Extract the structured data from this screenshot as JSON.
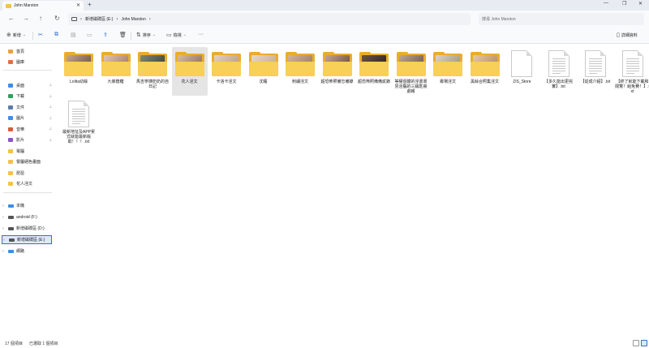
{
  "window": {
    "tab_title": "John Marston",
    "tab_close": "✕",
    "new_tab": "+",
    "minimize": "—",
    "maximize": "❐",
    "close": "✕"
  },
  "nav_buttons": {
    "back": "←",
    "forward": "→",
    "up": "↑",
    "refresh": "↻"
  },
  "breadcrumb": [
    "新增磁碟區 (E:)",
    "John Marston"
  ],
  "breadcrumb_separator": "›",
  "search": {
    "placeholder": "搜尋 John Marston"
  },
  "command_bar": {
    "new_label": "新增",
    "sort_label": "排序",
    "view_label": "檢視",
    "more_label": "···",
    "details_label": "詳細資料"
  },
  "navigation_pane": {
    "quick_items": [
      {
        "label": "首頁",
        "icon": "home-icon",
        "color": "#e9a23b",
        "pinned": false
      },
      {
        "label": "圖庫",
        "icon": "gallery-icon",
        "color": "#e0703a",
        "pinned": false
      }
    ],
    "pinned_items": [
      {
        "label": "桌面",
        "icon": "desktop-icon",
        "color": "#3a8ee6",
        "pinned": true
      },
      {
        "label": "下載",
        "icon": "download-icon",
        "color": "#2fa05a",
        "pinned": true
      },
      {
        "label": "文件",
        "icon": "documents-icon",
        "color": "#5a7ca8",
        "pinned": true
      },
      {
        "label": "圖片",
        "icon": "pictures-icon",
        "color": "#3a8ee6",
        "pinned": true
      },
      {
        "label": "音樂",
        "icon": "music-icon",
        "color": "#e4573a",
        "pinned": true
      },
      {
        "label": "影片",
        "icon": "videos-icon",
        "color": "#8a55c9",
        "pinned": true
      },
      {
        "label": "電腦",
        "icon": "folder-icon",
        "color": "#f3c343",
        "pinned": false
      },
      {
        "label": "督屬絕色畫面",
        "icon": "folder-icon",
        "color": "#f3c343",
        "pinned": false
      },
      {
        "label": "琵琶",
        "icon": "folder-icon",
        "color": "#f3c343",
        "pinned": false
      },
      {
        "label": "花人淫文",
        "icon": "folder-icon",
        "color": "#f3c343",
        "pinned": false
      }
    ],
    "pin_glyph": "📌",
    "drives": [
      {
        "label": "本機",
        "icon": "this-pc-icon",
        "color": "#3a8ee6",
        "selected": false
      },
      {
        "label": "android (F:)",
        "icon": "drive-icon",
        "color": "#555555",
        "selected": false
      },
      {
        "label": "新增磁碟區 (D:)",
        "icon": "drive-icon",
        "color": "#555555",
        "selected": false
      },
      {
        "label": "新增磁碟區 (E:)",
        "icon": "drive-icon",
        "color": "#555555",
        "selected": true
      },
      {
        "label": "網路",
        "icon": "network-icon",
        "color": "#3a8ee6",
        "selected": false
      }
    ],
    "chevron": "›"
  },
  "files": [
    {
      "name": "Lolita幼緣",
      "type": "folder",
      "preview": [
        "#c9a58a",
        "#6b5544"
      ]
    },
    {
      "name": "九條蔭糖",
      "type": "folder",
      "preview": [
        "#e2c7b2",
        "#a37a63"
      ]
    },
    {
      "name": "馬吉寧姨奶奶的自日記",
      "type": "folder",
      "preview": [
        "#7d8a74",
        "#3d4336"
      ]
    },
    {
      "name": "花人淫文",
      "type": "folder",
      "preview": [
        "#d8bca4",
        "#8f6f58"
      ],
      "selected": true
    },
    {
      "name": "卡洛卡淫文",
      "type": "folder",
      "preview": [
        "#e5d2bf",
        "#b99c82"
      ]
    },
    {
      "name": "沈睡",
      "type": "folder",
      "preview": [
        "#e8d8c8",
        "#c7a98c"
      ]
    },
    {
      "name": "刺繡淫文",
      "type": "folder",
      "preview": [
        "#d2b497",
        "#9d7c61"
      ]
    },
    {
      "name": "超恐怖照備忘備錄",
      "type": "folder",
      "preview": [
        "#c7a58d",
        "#6c4f3f"
      ]
    },
    {
      "name": "超恐怖照備備貳錄",
      "type": "folder",
      "preview": [
        "#6b5346",
        "#2e2420"
      ]
    },
    {
      "name": "等權個體的淫書書見淫腦的三鑰匙冊劇報",
      "type": "folder",
      "preview": [
        "#bfa88f",
        "#6e5a49"
      ]
    },
    {
      "name": "專場淫文",
      "type": "folder",
      "preview": [
        "#ddd6c4",
        "#9e9278"
      ]
    },
    {
      "name": "黑絲合照集淫文",
      "type": "folder",
      "preview": [
        "#e7c9a6",
        "#b38a63"
      ]
    },
    {
      "name": ".DS_Store",
      "type": "file",
      "preview": null
    },
    {
      "name": "【多久能出更完實】.txt",
      "type": "text",
      "preview": null
    },
    {
      "name": "【從成介紹】.txt",
      "type": "text",
      "preview": null
    },
    {
      "name": "【終了就能下載和閱覽！給免費！】.txt",
      "type": "text",
      "preview": null
    },
    {
      "name": "最新地址及APP累式就能最新版取！！！.txt",
      "type": "text",
      "preview": null
    }
  ],
  "status": {
    "item_count": "17 個項目",
    "selected_count": "已選取 1 個項目"
  }
}
